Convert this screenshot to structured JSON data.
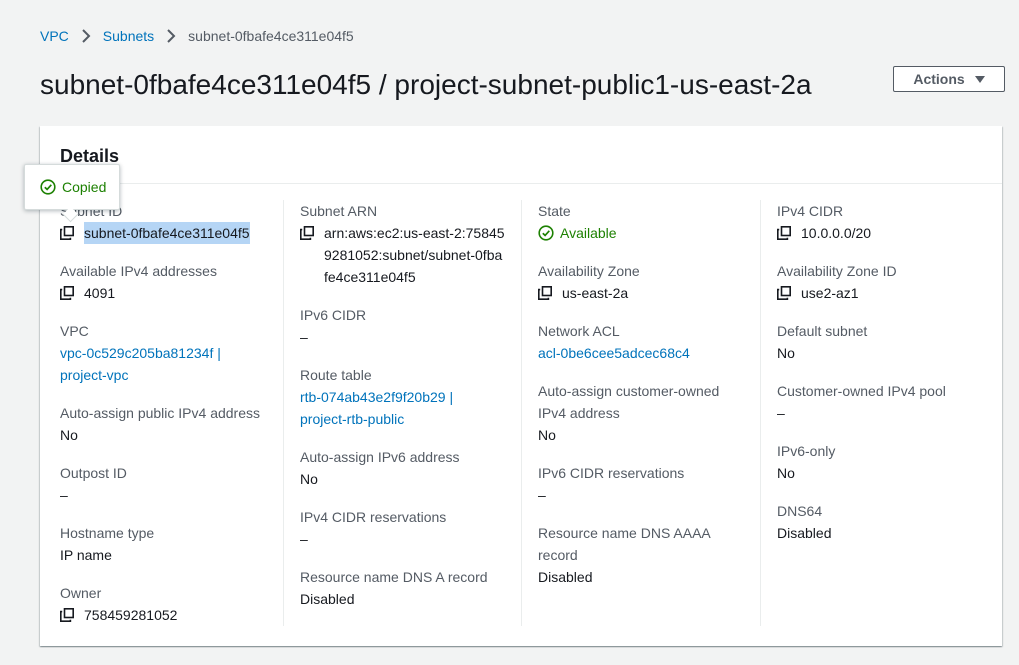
{
  "breadcrumb": {
    "vpc": "VPC",
    "subnets": "Subnets",
    "current": "subnet-0fbafe4ce311e04f5"
  },
  "header": {
    "title": "subnet-0fbafe4ce311e04f5 / project-subnet-public1-us-east-2a",
    "actions_label": "Actions"
  },
  "details": {
    "title": "Details",
    "tooltip": "Copied",
    "col1": {
      "subnet_id": {
        "label": "Subnet ID",
        "value": "subnet-0fbafe4ce311e04f5"
      },
      "available_ipv4": {
        "label": "Available IPv4 addresses",
        "value": "4091"
      },
      "vpc": {
        "label": "VPC",
        "value_line1": "vpc-0c529c205ba81234f |",
        "value_line2": "project-vpc"
      },
      "auto_assign_public_ipv4": {
        "label": "Auto-assign public IPv4 address",
        "value": "No"
      },
      "outpost_id": {
        "label": "Outpost ID",
        "value": "–"
      },
      "hostname_type": {
        "label": "Hostname type",
        "value": "IP name"
      },
      "owner": {
        "label": "Owner",
        "value": "758459281052"
      }
    },
    "col2": {
      "subnet_arn": {
        "label": "Subnet ARN",
        "value": "arn:aws:ec2:us-east-2:758459281052:subnet/subnet-0fbafe4ce311e04f5"
      },
      "ipv6_cidr": {
        "label": "IPv6 CIDR",
        "value": "–"
      },
      "route_table": {
        "label": "Route table",
        "value_line1": "rtb-074ab43e2f9f20b29 |",
        "value_line2": "project-rtb-public"
      },
      "auto_assign_ipv6": {
        "label": "Auto-assign IPv6 address",
        "value": "No"
      },
      "ipv4_cidr_reservations": {
        "label": "IPv4 CIDR reservations",
        "value": "–"
      },
      "resource_name_dns_a": {
        "label": "Resource name DNS A record",
        "value": "Disabled"
      }
    },
    "col3": {
      "state": {
        "label": "State",
        "value": "Available"
      },
      "availability_zone": {
        "label": "Availability Zone",
        "value": "us-east-2a"
      },
      "network_acl": {
        "label": "Network ACL",
        "value": "acl-0be6cee5adcec68c4"
      },
      "auto_assign_customer_owned": {
        "label": "Auto-assign customer-owned IPv4 address",
        "value": "No"
      },
      "ipv6_cidr_reservations": {
        "label": "IPv6 CIDR reservations",
        "value": "–"
      },
      "resource_name_dns_aaaa": {
        "label": "Resource name DNS AAAA record",
        "value": "Disabled"
      }
    },
    "col4": {
      "ipv4_cidr": {
        "label": "IPv4 CIDR",
        "value": "10.0.0.0/20"
      },
      "availability_zone_id": {
        "label": "Availability Zone ID",
        "value": "use2-az1"
      },
      "default_subnet": {
        "label": "Default subnet",
        "value": "No"
      },
      "customer_owned_ipv4_pool": {
        "label": "Customer-owned IPv4 pool",
        "value": "–"
      },
      "ipv6_only": {
        "label": "IPv6-only",
        "value": "No"
      },
      "dns64": {
        "label": "DNS64",
        "value": "Disabled"
      }
    }
  },
  "icons": {
    "copy": "copy-icon",
    "check": "check-circle-icon",
    "chevron": "chevron-right-icon",
    "caret": "caret-down-icon"
  },
  "colors": {
    "link": "#0073bb",
    "success": "#1d8102",
    "label": "#545b64",
    "text": "#16191f",
    "background": "#f2f3f3",
    "highlight": "#b5d5f5"
  }
}
